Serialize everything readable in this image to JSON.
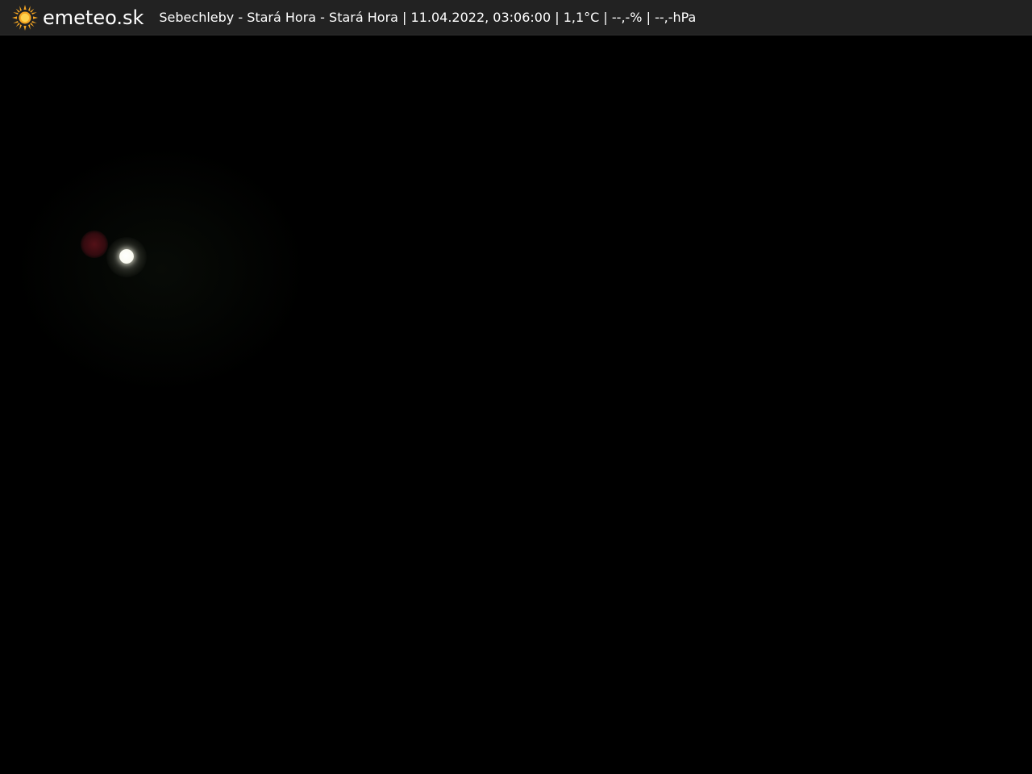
{
  "header": {
    "logo_icon": "sun-icon",
    "brand": "emeteo.sk",
    "caption": "Sebechleby - Stará Hora - Stará Hora | 11.04.2022, 03:06:00 | 1,1°C | --,-% | --,-hPa"
  },
  "colors": {
    "bar_background": "#222222",
    "sun_color": "#f5a623",
    "text": "#ffffff"
  }
}
